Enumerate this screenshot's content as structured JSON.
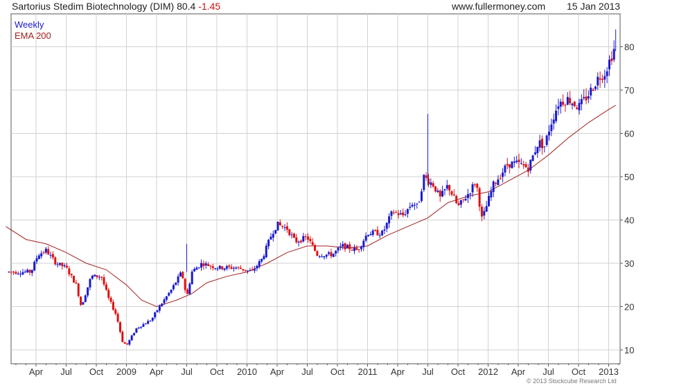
{
  "header": {
    "title": "Sartorius Stedim Biotechnology (DIM) 80.4",
    "change": "-1.45",
    "site": "www.fullermoney.com",
    "date": "15 Jan 2013"
  },
  "footer": {
    "copyright": "© 2013 Stockcube Research Ltd"
  },
  "colors": {
    "up": "#1a1acc",
    "down": "#dd1111",
    "ema": "#a32020",
    "grid": "#d2d2d2",
    "frame": "#555555"
  },
  "chart_data": {
    "type": "candlestick",
    "legend": [
      "Weekly",
      "EMA 200"
    ],
    "ylim": [
      7,
      86
    ],
    "yticks": [
      10,
      20,
      30,
      40,
      50,
      60,
      70,
      80
    ],
    "xlim": [
      0,
      42.6
    ],
    "x_unit": "months since Jan 2009 = 24",
    "xticks": [
      {
        "label": "Apr",
        "m": 3
      },
      {
        "label": "Jul",
        "m": 6
      },
      {
        "label": "Oct",
        "m": 9
      },
      {
        "label": "2009",
        "m": 12
      },
      {
        "label": "Apr",
        "m": 15
      },
      {
        "label": "Jul",
        "m": 18
      },
      {
        "label": "Oct",
        "m": 21
      },
      {
        "label": "2010",
        "m": 24
      },
      {
        "label": "Apr",
        "m": 27
      },
      {
        "label": "Jul",
        "m": 30
      },
      {
        "label": "Oct",
        "m": 33
      },
      {
        "label": "2011",
        "m": 36
      },
      {
        "label": "Apr",
        "m": 39
      },
      {
        "label": "Jul",
        "m": 42
      },
      {
        "label": "Oct",
        "m": 45
      },
      {
        "label": "2012",
        "m": 48
      },
      {
        "label": "Apr",
        "m": 51
      },
      {
        "label": "Jul",
        "m": 54
      },
      {
        "label": "Oct",
        "m": 57
      },
      {
        "label": "2013",
        "m": 60
      }
    ],
    "price_path": [
      [
        0.3,
        28
      ],
      [
        2.5,
        28
      ],
      [
        3.2,
        32
      ],
      [
        4.0,
        33
      ],
      [
        5.0,
        30
      ],
      [
        6.0,
        29
      ],
      [
        7.0,
        25
      ],
      [
        7.5,
        20
      ],
      [
        8.5,
        27
      ],
      [
        9.5,
        27
      ],
      [
        10.2,
        22
      ],
      [
        11.0,
        18
      ],
      [
        11.6,
        12
      ],
      [
        12.0,
        11
      ],
      [
        13.0,
        15
      ],
      [
        14.5,
        17
      ],
      [
        15.0,
        19
      ],
      [
        16.5,
        24
      ],
      [
        17.5,
        28
      ],
      [
        18.0,
        22
      ],
      [
        18.5,
        28
      ],
      [
        19.5,
        30
      ],
      [
        21.0,
        29
      ],
      [
        23.0,
        29
      ],
      [
        24.5,
        28
      ],
      [
        25.5,
        31
      ],
      [
        26.5,
        37
      ],
      [
        27.0,
        39
      ],
      [
        28.0,
        38
      ],
      [
        28.8,
        35
      ],
      [
        30.0,
        36
      ],
      [
        31.0,
        32
      ],
      [
        32.5,
        32
      ],
      [
        33.5,
        34
      ],
      [
        35.0,
        33
      ],
      [
        36.0,
        37
      ],
      [
        37.5,
        37
      ],
      [
        38.5,
        42
      ],
      [
        39.5,
        41
      ],
      [
        40.5,
        44
      ],
      [
        41.0,
        43
      ],
      [
        41.6,
        50
      ],
      [
        42.6,
        48
      ],
      [
        43.2,
        45
      ],
      [
        44.0,
        48
      ],
      [
        45.0,
        43
      ],
      [
        46.0,
        46
      ],
      [
        46.8,
        49
      ],
      [
        47.4,
        40
      ],
      [
        48.5,
        48
      ],
      [
        50.0,
        53
      ],
      [
        51.0,
        53
      ],
      [
        52.0,
        52
      ],
      [
        53.0,
        58
      ],
      [
        53.6,
        57
      ],
      [
        54.2,
        62
      ],
      [
        55.0,
        67
      ],
      [
        56.0,
        68
      ],
      [
        57.0,
        66
      ],
      [
        58.0,
        69
      ],
      [
        59.0,
        73
      ],
      [
        59.6,
        74
      ],
      [
        60.3,
        78
      ],
      [
        60.7,
        80.4
      ]
    ],
    "ema_200": [
      [
        0,
        38.5
      ],
      [
        2,
        35.5
      ],
      [
        4,
        34.5
      ],
      [
        6,
        32.5
      ],
      [
        8,
        30
      ],
      [
        10,
        28.5
      ],
      [
        12,
        25
      ],
      [
        13.5,
        21.5
      ],
      [
        15,
        20
      ],
      [
        17,
        21.5
      ],
      [
        18.5,
        23
      ],
      [
        20,
        25.5
      ],
      [
        22,
        27
      ],
      [
        24,
        28
      ],
      [
        26,
        30
      ],
      [
        28,
        32.5
      ],
      [
        30,
        34
      ],
      [
        32,
        34
      ],
      [
        34,
        33.5
      ],
      [
        36,
        34
      ],
      [
        38,
        36.5
      ],
      [
        40,
        38.5
      ],
      [
        42,
        40.5
      ],
      [
        44,
        44
      ],
      [
        46,
        45.5
      ],
      [
        48,
        46.5
      ],
      [
        50,
        49
      ],
      [
        52,
        51.5
      ],
      [
        54,
        55
      ],
      [
        56,
        59
      ],
      [
        58,
        62.5
      ],
      [
        60,
        65.5
      ],
      [
        60.7,
        66.5
      ]
    ]
  }
}
